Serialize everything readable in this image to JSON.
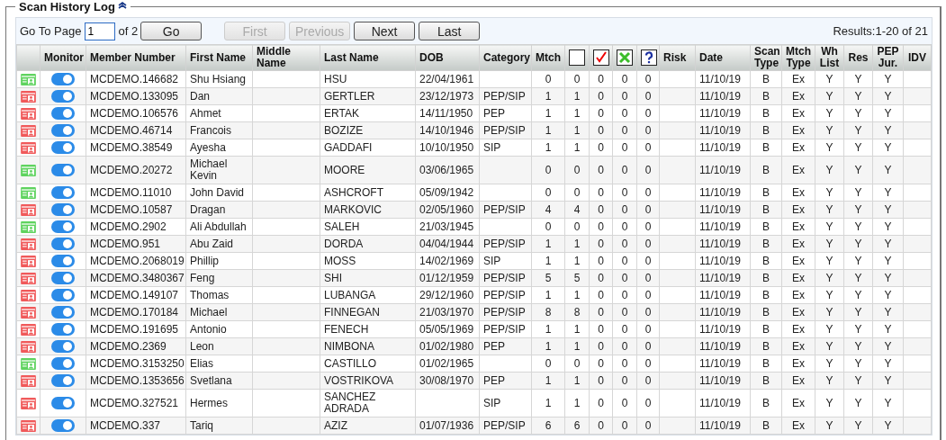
{
  "panel": {
    "title": "Scan History Log",
    "collapsed": false
  },
  "pager": {
    "label": "Go To Page",
    "value": "1",
    "of": "of 2",
    "go": "Go",
    "buttons": [
      {
        "label": "First",
        "disabled": true
      },
      {
        "label": "Previous",
        "disabled": true
      },
      {
        "label": "Next",
        "disabled": false
      },
      {
        "label": "Last",
        "disabled": false
      }
    ],
    "results": "Results:1-20 of 21"
  },
  "columns": [
    {
      "kind": "blank"
    },
    {
      "kind": "text",
      "label": "Monitor"
    },
    {
      "kind": "text",
      "label": "Member Number"
    },
    {
      "kind": "text",
      "label": "First Name"
    },
    {
      "kind": "text",
      "label": "Middle Name"
    },
    {
      "kind": "text",
      "label": "Last Name"
    },
    {
      "kind": "text",
      "label": "DOB"
    },
    {
      "kind": "text",
      "label": "Category"
    },
    {
      "kind": "text",
      "label": "Mtch"
    },
    {
      "kind": "icon"
    },
    {
      "kind": "icon"
    },
    {
      "kind": "icon"
    },
    {
      "kind": "icon"
    },
    {
      "kind": "text",
      "label": "Risk"
    },
    {
      "kind": "text",
      "label": "Date"
    },
    {
      "kind": "text",
      "label": "Scan Type"
    },
    {
      "kind": "text",
      "label": "Mtch Type"
    },
    {
      "kind": "text",
      "label": "Wh List"
    },
    {
      "kind": "text",
      "label": "Res"
    },
    {
      "kind": "text",
      "label": "PEP Jur."
    },
    {
      "kind": "text",
      "label": "IDV"
    }
  ],
  "rows": [
    {
      "color": "#5fd35f",
      "monitor": true,
      "cells": [
        "MCDEMO.146682",
        "Shu Hsiang",
        null,
        "HSU",
        "22/04/1961",
        null,
        "0",
        "0",
        "0",
        "0",
        "0",
        null,
        "11/10/19",
        "B",
        "Ex",
        "Y",
        "Y",
        "Y",
        null
      ]
    },
    {
      "color": "#f0595a",
      "monitor": true,
      "cells": [
        "MCDEMO.133095",
        "Dan",
        null,
        "GERTLER",
        "23/12/1973",
        "PEP/SIP",
        "1",
        "1",
        "0",
        "0",
        "0",
        null,
        "11/10/19",
        "B",
        "Ex",
        "Y",
        "Y",
        "Y",
        null
      ]
    },
    {
      "color": "#f0595a",
      "monitor": true,
      "cells": [
        "MCDEMO.106576",
        "Ahmet",
        null,
        "ERTAK",
        "14/11/1950",
        "PEP",
        "1",
        "1",
        "0",
        "0",
        "0",
        null,
        "11/10/19",
        "B",
        "Ex",
        "Y",
        "Y",
        "Y",
        null
      ]
    },
    {
      "color": "#f0595a",
      "monitor": true,
      "cells": [
        "MCDEMO.46714",
        "Francois",
        null,
        "BOZIZE",
        "14/10/1946",
        "PEP/SIP",
        "1",
        "1",
        "0",
        "0",
        "0",
        null,
        "11/10/19",
        "B",
        "Ex",
        "Y",
        "Y",
        "Y",
        null
      ]
    },
    {
      "color": "#f0595a",
      "monitor": true,
      "cells": [
        "MCDEMO.38549",
        "Ayesha",
        null,
        "GADDAFI",
        "10/10/1950",
        "SIP",
        "1",
        "1",
        "0",
        "0",
        "0",
        null,
        "11/10/19",
        "B",
        "Ex",
        "Y",
        "Y",
        "Y",
        null
      ]
    },
    {
      "color": "#5fd35f",
      "monitor": true,
      "cells": [
        "MCDEMO.20272",
        "Michael Kevin",
        null,
        "MOORE",
        "03/06/1965",
        null,
        "0",
        "0",
        "0",
        "0",
        "0",
        null,
        "11/10/19",
        "B",
        "Ex",
        "Y",
        "Y",
        "Y",
        null
      ]
    },
    {
      "color": "#5fd35f",
      "monitor": true,
      "cells": [
        "MCDEMO.11010",
        "John David",
        null,
        "ASHCROFT",
        "05/09/1942",
        null,
        "0",
        "0",
        "0",
        "0",
        "0",
        null,
        "11/10/19",
        "B",
        "Ex",
        "Y",
        "Y",
        "Y",
        null
      ]
    },
    {
      "color": "#f0595a",
      "monitor": true,
      "cells": [
        "MCDEMO.10587",
        "Dragan",
        null,
        "MARKOVIC",
        "02/05/1960",
        "PEP/SIP",
        "4",
        "4",
        "0",
        "0",
        "0",
        null,
        "11/10/19",
        "B",
        "Ex",
        "Y",
        "Y",
        "Y",
        null
      ]
    },
    {
      "color": "#5fd35f",
      "monitor": true,
      "cells": [
        "MCDEMO.2902",
        "Ali Abdullah",
        null,
        "SALEH",
        "21/03/1945",
        null,
        "0",
        "0",
        "0",
        "0",
        "0",
        null,
        "11/10/19",
        "B",
        "Ex",
        "Y",
        "Y",
        "Y",
        null
      ]
    },
    {
      "color": "#f0595a",
      "monitor": true,
      "cells": [
        "MCDEMO.951",
        "Abu Zaid",
        null,
        "DORDA",
        "04/04/1944",
        "PEP/SIP",
        "1",
        "1",
        "0",
        "0",
        "0",
        null,
        "11/10/19",
        "B",
        "Ex",
        "Y",
        "Y",
        "Y",
        null
      ]
    },
    {
      "color": "#f0595a",
      "monitor": true,
      "cells": [
        "MCDEMO.2068019",
        "Phillip",
        null,
        "MOSS",
        "14/02/1969",
        "SIP",
        "1",
        "1",
        "0",
        "0",
        "0",
        null,
        "11/10/19",
        "B",
        "Ex",
        "Y",
        "Y",
        "Y",
        null
      ]
    },
    {
      "color": "#f0595a",
      "monitor": true,
      "cells": [
        "MCDEMO.3480367",
        "Feng",
        null,
        "SHI",
        "01/12/1959",
        "PEP/SIP",
        "5",
        "5",
        "0",
        "0",
        "0",
        null,
        "11/10/19",
        "B",
        "Ex",
        "Y",
        "Y",
        "Y",
        null
      ]
    },
    {
      "color": "#f0595a",
      "monitor": true,
      "cells": [
        "MCDEMO.149107",
        "Thomas",
        null,
        "LUBANGA",
        "29/12/1960",
        "PEP/SIP",
        "1",
        "1",
        "0",
        "0",
        "0",
        null,
        "11/10/19",
        "B",
        "Ex",
        "Y",
        "Y",
        "Y",
        null
      ]
    },
    {
      "color": "#f0595a",
      "monitor": true,
      "cells": [
        "MCDEMO.170184",
        "Michael",
        null,
        "FINNEGAN",
        "21/03/1970",
        "PEP/SIP",
        "8",
        "8",
        "0",
        "0",
        "0",
        null,
        "11/10/19",
        "B",
        "Ex",
        "Y",
        "Y",
        "Y",
        null
      ]
    },
    {
      "color": "#f0595a",
      "monitor": true,
      "cells": [
        "MCDEMO.191695",
        "Antonio",
        null,
        "FENECH",
        "05/05/1969",
        "PEP/SIP",
        "1",
        "1",
        "0",
        "0",
        "0",
        null,
        "11/10/19",
        "B",
        "Ex",
        "Y",
        "Y",
        "Y",
        null
      ]
    },
    {
      "color": "#f0595a",
      "monitor": true,
      "cells": [
        "MCDEMO.2369",
        "Leon",
        null,
        "NIMBONA",
        "01/02/1980",
        "PEP",
        "1",
        "1",
        "0",
        "0",
        "0",
        null,
        "11/10/19",
        "B",
        "Ex",
        "Y",
        "Y",
        "Y",
        null
      ]
    },
    {
      "color": "#5fd35f",
      "monitor": true,
      "cells": [
        "MCDEMO.3153250",
        "Elias",
        null,
        "CASTILLO",
        "01/02/1965",
        null,
        "0",
        "0",
        "0",
        "0",
        "0",
        null,
        "11/10/19",
        "B",
        "Ex",
        "Y",
        "Y",
        "Y",
        null
      ]
    },
    {
      "color": "#f0595a",
      "monitor": true,
      "cells": [
        "MCDEMO.1353656",
        "Svetlana",
        null,
        "VOSTRIKOVA",
        "30/08/1970",
        "PEP",
        "1",
        "1",
        "0",
        "0",
        "0",
        null,
        "11/10/19",
        "B",
        "Ex",
        "Y",
        "Y",
        "Y",
        null
      ]
    },
    {
      "color": "#f0595a",
      "monitor": true,
      "cells": [
        "MCDEMO.327521",
        "Hermes",
        null,
        "SANCHEZ ADRADA",
        null,
        "SIP",
        "1",
        "1",
        "0",
        "0",
        "0",
        null,
        "11/10/19",
        "B",
        "Ex",
        "Y",
        "Y",
        "Y",
        null
      ]
    },
    {
      "color": "#f0595a",
      "monitor": true,
      "cells": [
        "MCDEMO.337",
        "Tariq",
        null,
        "AZIZ",
        "01/07/1936",
        "PEP/SIP",
        "6",
        "6",
        "0",
        "0",
        "0",
        null,
        "11/10/19",
        "B",
        "Ex",
        "Y",
        "Y",
        "Y",
        null
      ]
    }
  ]
}
